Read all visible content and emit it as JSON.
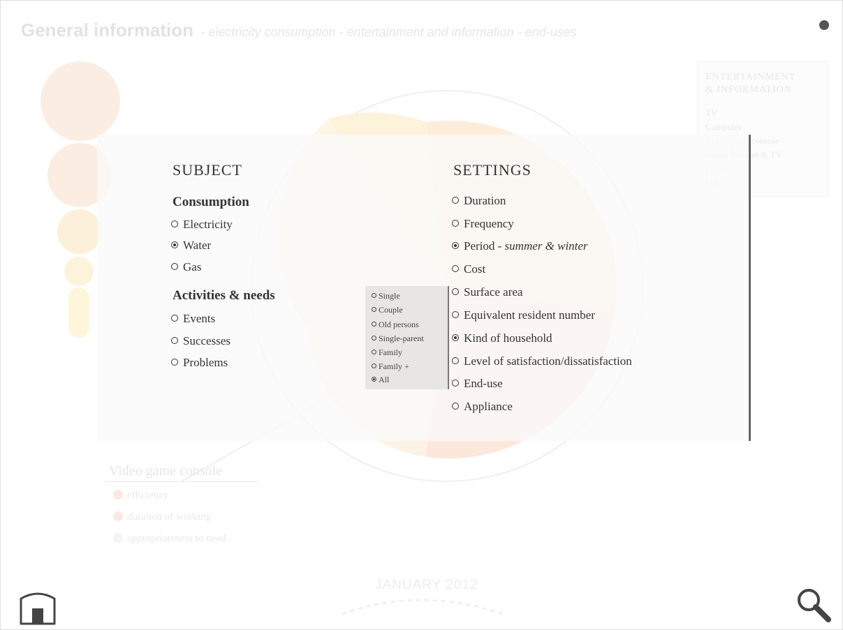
{
  "header": {
    "title": "General information",
    "subtitle": "- electricity consumption - entertainment and information - end-uses"
  },
  "legend": {
    "title_line1": "ENTERTAINMENT",
    "title_line2": "& INFORMATION",
    "items": [
      "TV",
      "Computer",
      "Video game console",
      "Boxes Internet & TV",
      "Phones",
      "Other"
    ]
  },
  "detail": {
    "title": "Video game console",
    "items": [
      {
        "label": "efficiency",
        "color": "#f0855a"
      },
      {
        "label": "duration of working",
        "color": "#f0855a"
      },
      {
        "label": "appropriateness to need",
        "color": "#cccccc"
      }
    ]
  },
  "timeline": {
    "month": "JANUARY 2012"
  },
  "subject": {
    "heading": "SUBJECT",
    "consumption": {
      "label": "Consumption",
      "options": [
        {
          "label": "Electricity",
          "selected": false
        },
        {
          "label": "Water",
          "selected": true
        },
        {
          "label": "Gas",
          "selected": false
        }
      ]
    },
    "activities": {
      "label": "Activities & needs",
      "options": [
        {
          "label": "Events",
          "selected": false
        },
        {
          "label": "Successes",
          "selected": false
        },
        {
          "label": "Problems",
          "selected": false
        }
      ]
    }
  },
  "household": {
    "options": [
      {
        "label": "Single",
        "selected": false
      },
      {
        "label": "Couple",
        "selected": false
      },
      {
        "label": "Old persons",
        "selected": false
      },
      {
        "label": "Single-parent",
        "selected": false
      },
      {
        "label": "Family",
        "selected": false
      },
      {
        "label": "Family +",
        "selected": false
      },
      {
        "label": "All",
        "selected": true
      }
    ]
  },
  "settings": {
    "heading": "SETTINGS",
    "options": [
      {
        "label": "Duration",
        "selected": false
      },
      {
        "label": "Frequency",
        "selected": false
      },
      {
        "label": "Period - ",
        "detail": "summer & winter",
        "selected": true
      },
      {
        "label": "Cost",
        "selected": false
      },
      {
        "label": "Surface area",
        "selected": false
      },
      {
        "label": "Equivalent resident number",
        "selected": false
      },
      {
        "label": "Kind of household",
        "selected": true
      },
      {
        "label": "Level of satisfaction/dissatisfaction",
        "selected": false
      },
      {
        "label": "End-use",
        "selected": false
      },
      {
        "label": "Appliance",
        "selected": false
      }
    ]
  },
  "icons": {
    "home": "home-icon",
    "search": "magnifier-icon",
    "menu": "dot-icon"
  }
}
